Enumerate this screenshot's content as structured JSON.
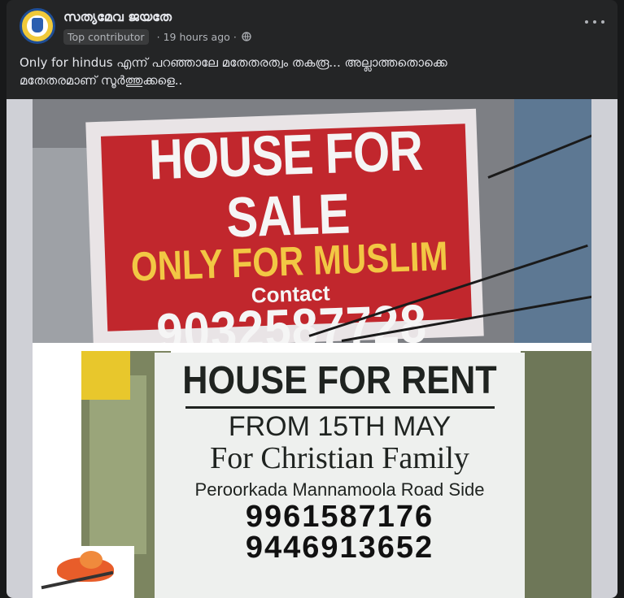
{
  "post": {
    "page_name": "സത്യമേവ ജയതേ",
    "badge": "Top contributor",
    "separator": "·",
    "timestamp": "19 hours ago",
    "privacy_icon": "globe-icon",
    "more_icon": "more-horizontal-icon",
    "caption_line1": "Only for hindus എന്ന് പറഞ്ഞാലേ മതേതരത്വം തകരൂ... അല്ലാത്തതൊക്കെ",
    "caption_line2": "മതേതരമാണ് സൂർത്തുക്കളെ.."
  },
  "image": {
    "sale_sign": {
      "line1": "HOUSE FOR SALE",
      "line2": "ONLY FOR MUSLIM",
      "line3": "Contact",
      "line4": "9032587728"
    },
    "rent_sign": {
      "line1": "HOUSE FOR RENT",
      "line2": "FROM 15TH MAY",
      "line3": "For Christian Family",
      "line4": "Peroorkada Mannamoola Road Side",
      "line5": "9961587176",
      "line6": "9446913652"
    }
  },
  "colors": {
    "card_bg": "#242526",
    "text_primary": "#e4e6eb",
    "text_secondary": "#b0b3b8",
    "sale_red": "#c1272d",
    "sale_yellow": "#f2c744"
  }
}
